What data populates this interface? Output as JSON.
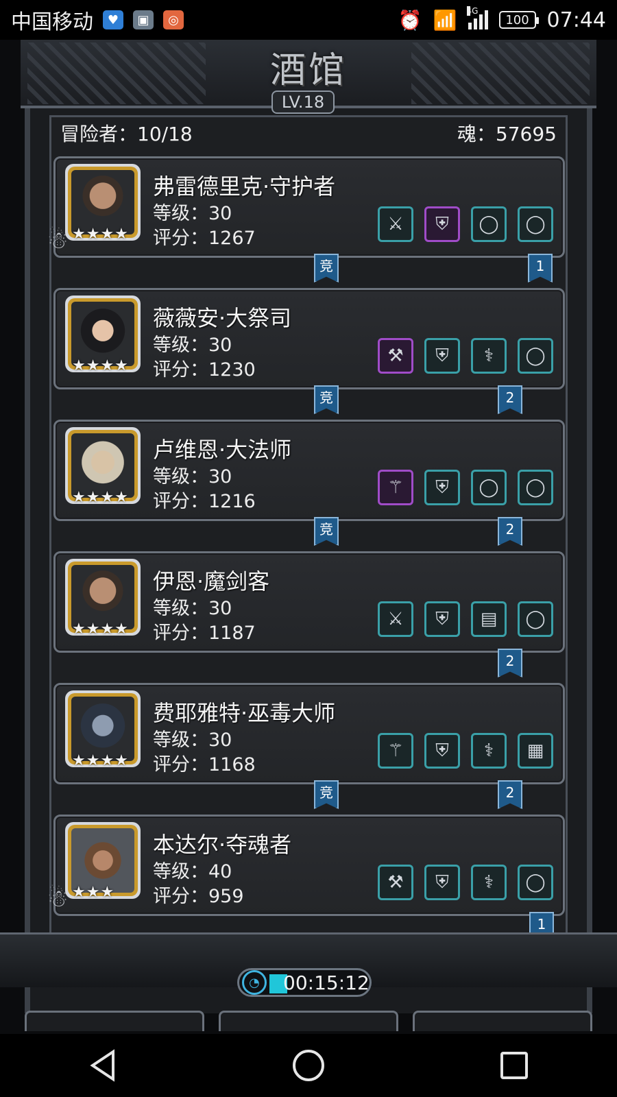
{
  "status_bar": {
    "carrier": "中国移动",
    "network": "4G",
    "battery": "100",
    "time": "07:44"
  },
  "tavern": {
    "title": "酒馆",
    "level": "LV.18",
    "adventurers_label": "冒险者：10/18",
    "soul_label": "魂：57695"
  },
  "heroes": [
    {
      "name": "弗雷德里克·守护者",
      "level": "等级：30",
      "score": "评分：1267",
      "stars": "★★★★",
      "compete": "竞",
      "count": "1",
      "slots": [
        "⚔",
        "⛨",
        "◯",
        "◯"
      ]
    },
    {
      "name": "薇薇安·大祭司",
      "level": "等级：30",
      "score": "评分：1230",
      "stars": "★★★★",
      "compete": "竞",
      "count": "2",
      "slots": [
        "⚒",
        "⛨",
        "⚕",
        "◯"
      ]
    },
    {
      "name": "卢维恩·大法师",
      "level": "等级：30",
      "score": "评分：1216",
      "stars": "★★★★",
      "compete": "竞",
      "count": "2",
      "slots": [
        "⚚",
        "⛨",
        "◯",
        "◯"
      ]
    },
    {
      "name": "伊恩·魔剑客",
      "level": "等级：30",
      "score": "评分：1187",
      "stars": "★★★★",
      "count": "2",
      "slots": [
        "⚔",
        "⛨",
        "▤",
        "◯"
      ]
    },
    {
      "name": "费耶雅特·巫毒大师",
      "level": "等级：30",
      "score": "评分：1168",
      "stars": "★★★★",
      "compete": "竞",
      "count": "2",
      "slots": [
        "⚚",
        "⛨",
        "⚕",
        "▦"
      ]
    },
    {
      "name": "本达尔·夺魂者",
      "level": "等级：40",
      "score": "评分：959",
      "stars": "★★★",
      "count": "1",
      "slots": [
        "⚒",
        "⛨",
        "⚕",
        "◯"
      ]
    }
  ],
  "timer": {
    "time": "00:15:12"
  }
}
